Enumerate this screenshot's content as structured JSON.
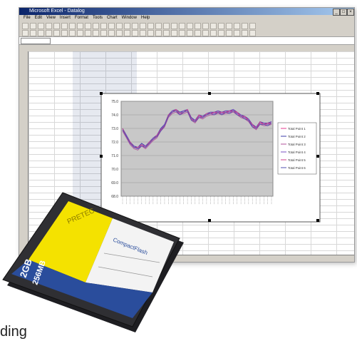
{
  "window": {
    "title": "Microsoft Excel - Datalog",
    "menu": [
      "File",
      "Edit",
      "View",
      "Insert",
      "Format",
      "Tools",
      "Chart",
      "Window",
      "Help"
    ]
  },
  "chart_data": {
    "type": "line",
    "yticks": [
      "75.0",
      "74.0",
      "73.0",
      "72.0",
      "71.0",
      "70.0",
      "69.0",
      "68.0"
    ],
    "ylim": [
      68,
      75
    ],
    "x": [
      1,
      2,
      3,
      4,
      5,
      6,
      7,
      8,
      9,
      10,
      11,
      12,
      13,
      14,
      15,
      16,
      17,
      18,
      19,
      20,
      21,
      22,
      23,
      24,
      25,
      26,
      27,
      28,
      29,
      30,
      31,
      32,
      33,
      34,
      35,
      36,
      37,
      38,
      39,
      40
    ],
    "series": [
      {
        "name": "Total Point 1",
        "values": [
          72.9,
          72.4,
          71.9,
          71.6,
          71.5,
          71.8,
          71.6,
          71.9,
          72.2,
          72.4,
          72.9,
          73.2,
          73.9,
          74.2,
          74.3,
          74.1,
          74.2,
          74.3,
          73.7,
          73.5,
          73.9,
          73.8,
          74.0,
          74.1,
          74.1,
          74.2,
          74.1,
          74.2,
          74.2,
          74.3,
          74.1,
          73.9,
          73.8,
          73.6,
          73.2,
          73.0,
          73.4,
          73.3,
          73.3,
          73.4
        ]
      },
      {
        "name": "Total Point 2",
        "values": [
          73.0,
          72.5,
          72.0,
          71.7,
          71.6,
          71.9,
          71.7,
          72.0,
          72.3,
          72.5,
          73.0,
          73.3,
          74.0,
          74.3,
          74.4,
          74.2,
          74.3,
          74.4,
          73.8,
          73.6,
          74.0,
          73.9,
          74.1,
          74.2,
          74.2,
          74.3,
          74.2,
          74.3,
          74.3,
          74.4,
          74.2,
          74.0,
          73.9,
          73.7,
          73.3,
          73.1,
          73.5,
          73.4,
          73.4,
          73.5
        ]
      },
      {
        "name": "Total Point 3",
        "values": [
          72.8,
          72.3,
          71.8,
          71.5,
          71.4,
          71.7,
          71.5,
          71.8,
          72.1,
          72.3,
          72.8,
          73.1,
          73.8,
          74.1,
          74.2,
          74.0,
          74.1,
          74.2,
          73.6,
          73.4,
          73.8,
          73.7,
          73.9,
          74.0,
          74.0,
          74.1,
          74.0,
          74.1,
          74.1,
          74.2,
          74.0,
          73.8,
          73.7,
          73.5,
          73.1,
          72.9,
          73.3,
          73.2,
          73.2,
          73.3
        ]
      },
      {
        "name": "Total Point 4",
        "values": [
          72.9,
          72.5,
          71.9,
          71.7,
          71.5,
          71.8,
          71.7,
          71.9,
          72.3,
          72.4,
          72.9,
          73.3,
          73.9,
          74.3,
          74.3,
          74.1,
          74.3,
          74.3,
          73.7,
          73.6,
          73.9,
          73.9,
          74.0,
          74.2,
          74.1,
          74.3,
          74.1,
          74.3,
          74.2,
          74.4,
          74.1,
          74.0,
          73.8,
          73.7,
          73.2,
          73.1,
          73.4,
          73.4,
          73.3,
          73.5
        ]
      },
      {
        "name": "Total Point 5",
        "values": [
          73.0,
          72.4,
          72.0,
          71.6,
          71.6,
          71.8,
          71.6,
          72.0,
          72.2,
          72.5,
          72.9,
          73.2,
          74.0,
          74.2,
          74.4,
          74.1,
          74.2,
          74.4,
          73.7,
          73.5,
          74.0,
          73.8,
          74.1,
          74.1,
          74.2,
          74.2,
          74.2,
          74.2,
          74.3,
          74.3,
          74.2,
          73.9,
          73.9,
          73.6,
          73.3,
          73.0,
          73.5,
          73.3,
          73.4,
          73.4
        ]
      },
      {
        "name": "Total Point 6",
        "values": [
          72.9,
          72.4,
          71.9,
          71.6,
          71.5,
          71.7,
          71.6,
          71.9,
          72.2,
          72.4,
          72.8,
          73.2,
          73.9,
          74.2,
          74.3,
          74.0,
          74.2,
          74.3,
          73.6,
          73.5,
          73.8,
          73.8,
          74.0,
          74.1,
          74.0,
          74.2,
          74.0,
          74.2,
          74.1,
          74.3,
          74.0,
          73.9,
          73.7,
          73.6,
          73.1,
          73.0,
          73.3,
          73.3,
          73.2,
          73.4
        ]
      }
    ],
    "colors": [
      "#e53b8f",
      "#3a3aa8",
      "#b0509a",
      "#7a4fc0",
      "#d0408a",
      "#5050b0"
    ],
    "plot_bg": "#c8c8c8",
    "grid": true,
    "legend_position": "right"
  },
  "card": {
    "brand": "PRETEC",
    "product": "CompactFlash",
    "capacity_line1": "2GB",
    "capacity_line2": "256MB",
    "colors": {
      "yellow": "#f4e200",
      "blue": "#2a4d9c",
      "white": "#f3f3f3",
      "body": "#2f2f33"
    }
  },
  "caption": "ding"
}
